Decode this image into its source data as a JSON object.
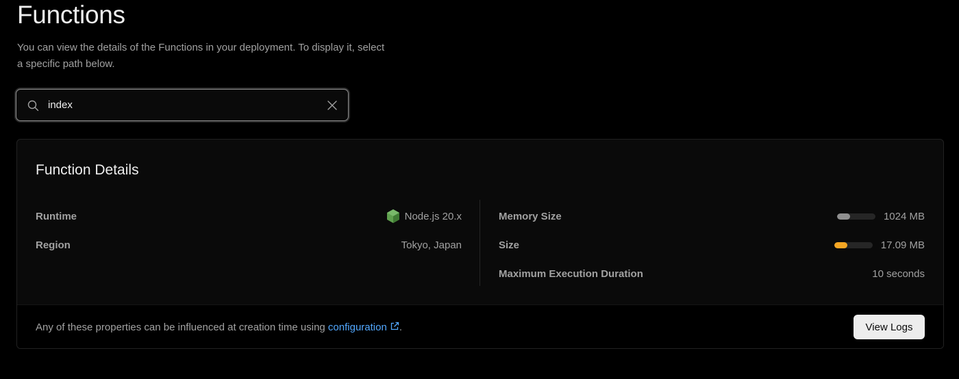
{
  "header": {
    "title": "Functions",
    "description": "You can view the details of the Functions in your deployment. To display it, select a specific path below."
  },
  "search": {
    "value": "index",
    "icon": "search-icon",
    "clear_icon": "close-icon"
  },
  "details": {
    "title": "Function Details",
    "left": [
      {
        "label": "Runtime",
        "value": "Node.js 20.x",
        "icon": "nodejs-icon"
      },
      {
        "label": "Region",
        "value": "Tokyo, Japan"
      }
    ],
    "right": [
      {
        "label": "Memory Size",
        "value": "1024 MB",
        "usage_percent": 34,
        "bar_color": "#8f8f8f"
      },
      {
        "label": "Size",
        "value": "17.09 MB",
        "usage_percent": 34,
        "bar_color": "#f5a623"
      },
      {
        "label": "Maximum Execution Duration",
        "value": "10 seconds"
      }
    ]
  },
  "footer": {
    "text_before": "Any of these properties can be influenced at creation time using ",
    "link_label": "configuration",
    "text_after": ".",
    "view_logs_label": "View Logs"
  },
  "colors": {
    "background": "#000000",
    "card": "#0a0a0a",
    "link": "#52a8ff",
    "node_green": "#5fa04e",
    "size_bar": "#f5a623"
  }
}
